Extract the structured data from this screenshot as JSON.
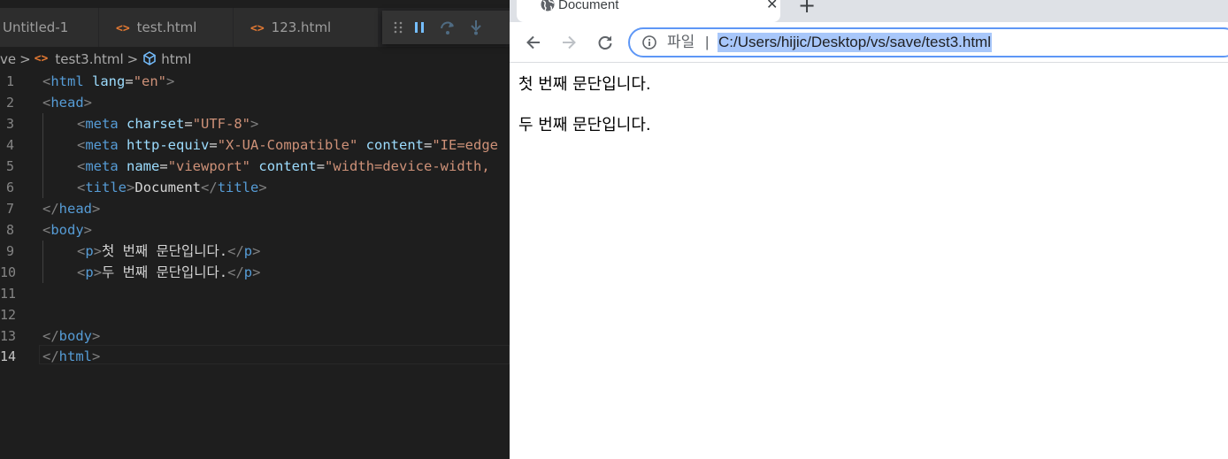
{
  "editor": {
    "tabs": [
      {
        "label": "Untitled-1",
        "icon": "none"
      },
      {
        "label": "test.html",
        "icon": "html-code-icon"
      },
      {
        "label": "123.html",
        "icon": "html-code-icon"
      }
    ],
    "breadcrumb": {
      "folder": "ve",
      "file": "test3.html",
      "symbol": "html"
    },
    "code_icon_glyph": "<>",
    "breadcrumb_separator": ">",
    "lines": [
      {
        "n": "1"
      },
      {
        "n": "2"
      },
      {
        "n": "3"
      },
      {
        "n": "4"
      },
      {
        "n": "5"
      },
      {
        "n": "6"
      },
      {
        "n": "7"
      },
      {
        "n": "8"
      },
      {
        "n": "9"
      },
      {
        "n": "10"
      },
      {
        "n": "11"
      },
      {
        "n": "12"
      },
      {
        "n": "13"
      },
      {
        "n": "14"
      }
    ],
    "tokens": {
      "lt": "<",
      "gt": ">",
      "lt_slash": "</",
      "eq": "=",
      "html": "html",
      "head": "head",
      "meta": "meta",
      "title": "title",
      "body": "body",
      "p": "p",
      "lang": "lang",
      "lang_val": "\"en\"",
      "charset": "charset",
      "charset_val": "\"UTF-8\"",
      "http_equiv": "http-equiv",
      "http_equiv_val": "\"X-UA-Compatible\"",
      "content": "content",
      "content_val_ie": "\"IE=edge",
      "name": "name",
      "name_val": "\"viewport\"",
      "content_val_vp": "\"width=device-width,",
      "title_text": "Document",
      "p1_text": "첫 번째 문단입니다.",
      "p2_text": "두 번째 문단입니다."
    },
    "colors": {
      "tag": "#569cd6",
      "attribute": "#9cdcfe",
      "string": "#ce9178",
      "bracket": "#808080",
      "text": "#d4d4d4",
      "icon_orange": "#e37933"
    }
  },
  "debug_toolbar": {
    "buttons": [
      "drag-handle-icon",
      "pause-icon",
      "step-over-icon",
      "step-into-icon"
    ]
  },
  "browser": {
    "tab_title": "Document",
    "tab_close": "✕",
    "new_tab": "+",
    "omnibox": {
      "scheme_label": "파일",
      "separator": "|",
      "url": "C:/Users/hijic/Desktop/vs/save/test3.html"
    },
    "page": {
      "paragraphs": [
        "첫 번째 문단입니다.",
        "두 번째 문단입니다."
      ]
    }
  }
}
